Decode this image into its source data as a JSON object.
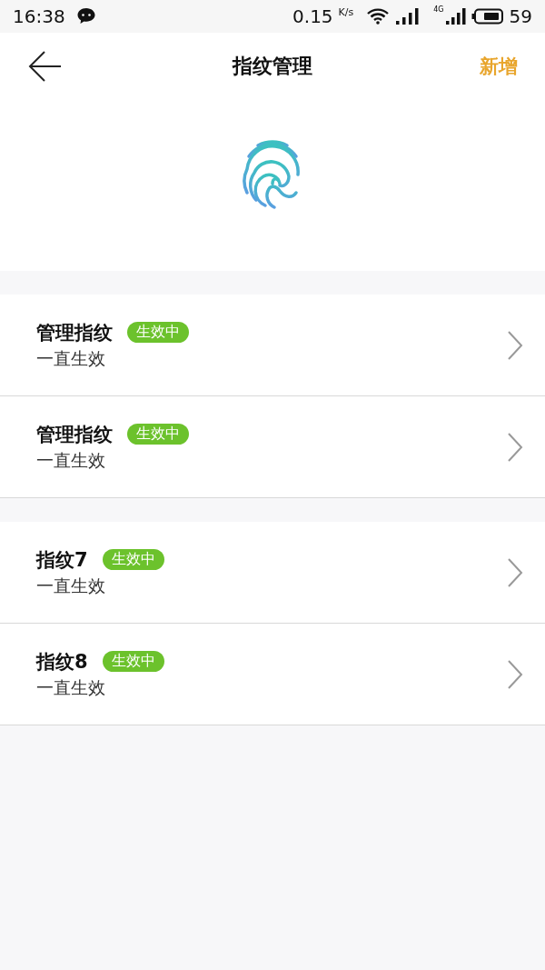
{
  "status_bar": {
    "time": "16:38",
    "speed": "0.15",
    "speed_unit": "K/s",
    "network": "4G",
    "battery": "59"
  },
  "header": {
    "title": "指纹管理",
    "action": "新增"
  },
  "groups": [
    {
      "items": [
        {
          "name": "管理指纹",
          "badge": "生效中",
          "validity": "一直生效"
        },
        {
          "name": "管理指纹",
          "badge": "生效中",
          "validity": "一直生效"
        }
      ]
    },
    {
      "items": [
        {
          "name": "指纹7",
          "badge": "生效中",
          "validity": "一直生效"
        },
        {
          "name": "指纹8",
          "badge": "生效中",
          "validity": "一直生效"
        }
      ]
    }
  ]
}
